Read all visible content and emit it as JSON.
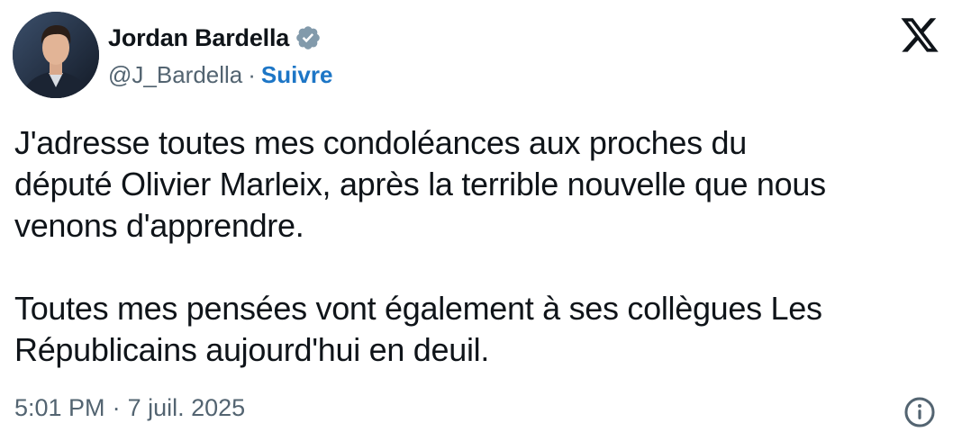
{
  "author": {
    "display_name": "Jordan Bardella",
    "handle": "@J_Bardella",
    "separator": "·",
    "follow_label": "Suivre",
    "verified_icon": "verified-badge-icon",
    "verified_color": "#829aab"
  },
  "tweet": {
    "text": "J'adresse toutes mes condoléances aux proches du\ndéputé Olivier Marleix, après la terrible nouvelle que nous\nvenons d'apprendre.\n\nToutes mes pensées vont également à ses collègues Les\nRépublicains aujourd'hui en deuil.",
    "time": "5:01 PM",
    "separator": "·",
    "date": "7 juil. 2025"
  },
  "icons": {
    "brand": "x-logo-icon",
    "info": "info-icon"
  },
  "colors": {
    "accent": "#1d76c6",
    "text_primary": "#0f1419",
    "text_secondary": "#536471"
  }
}
